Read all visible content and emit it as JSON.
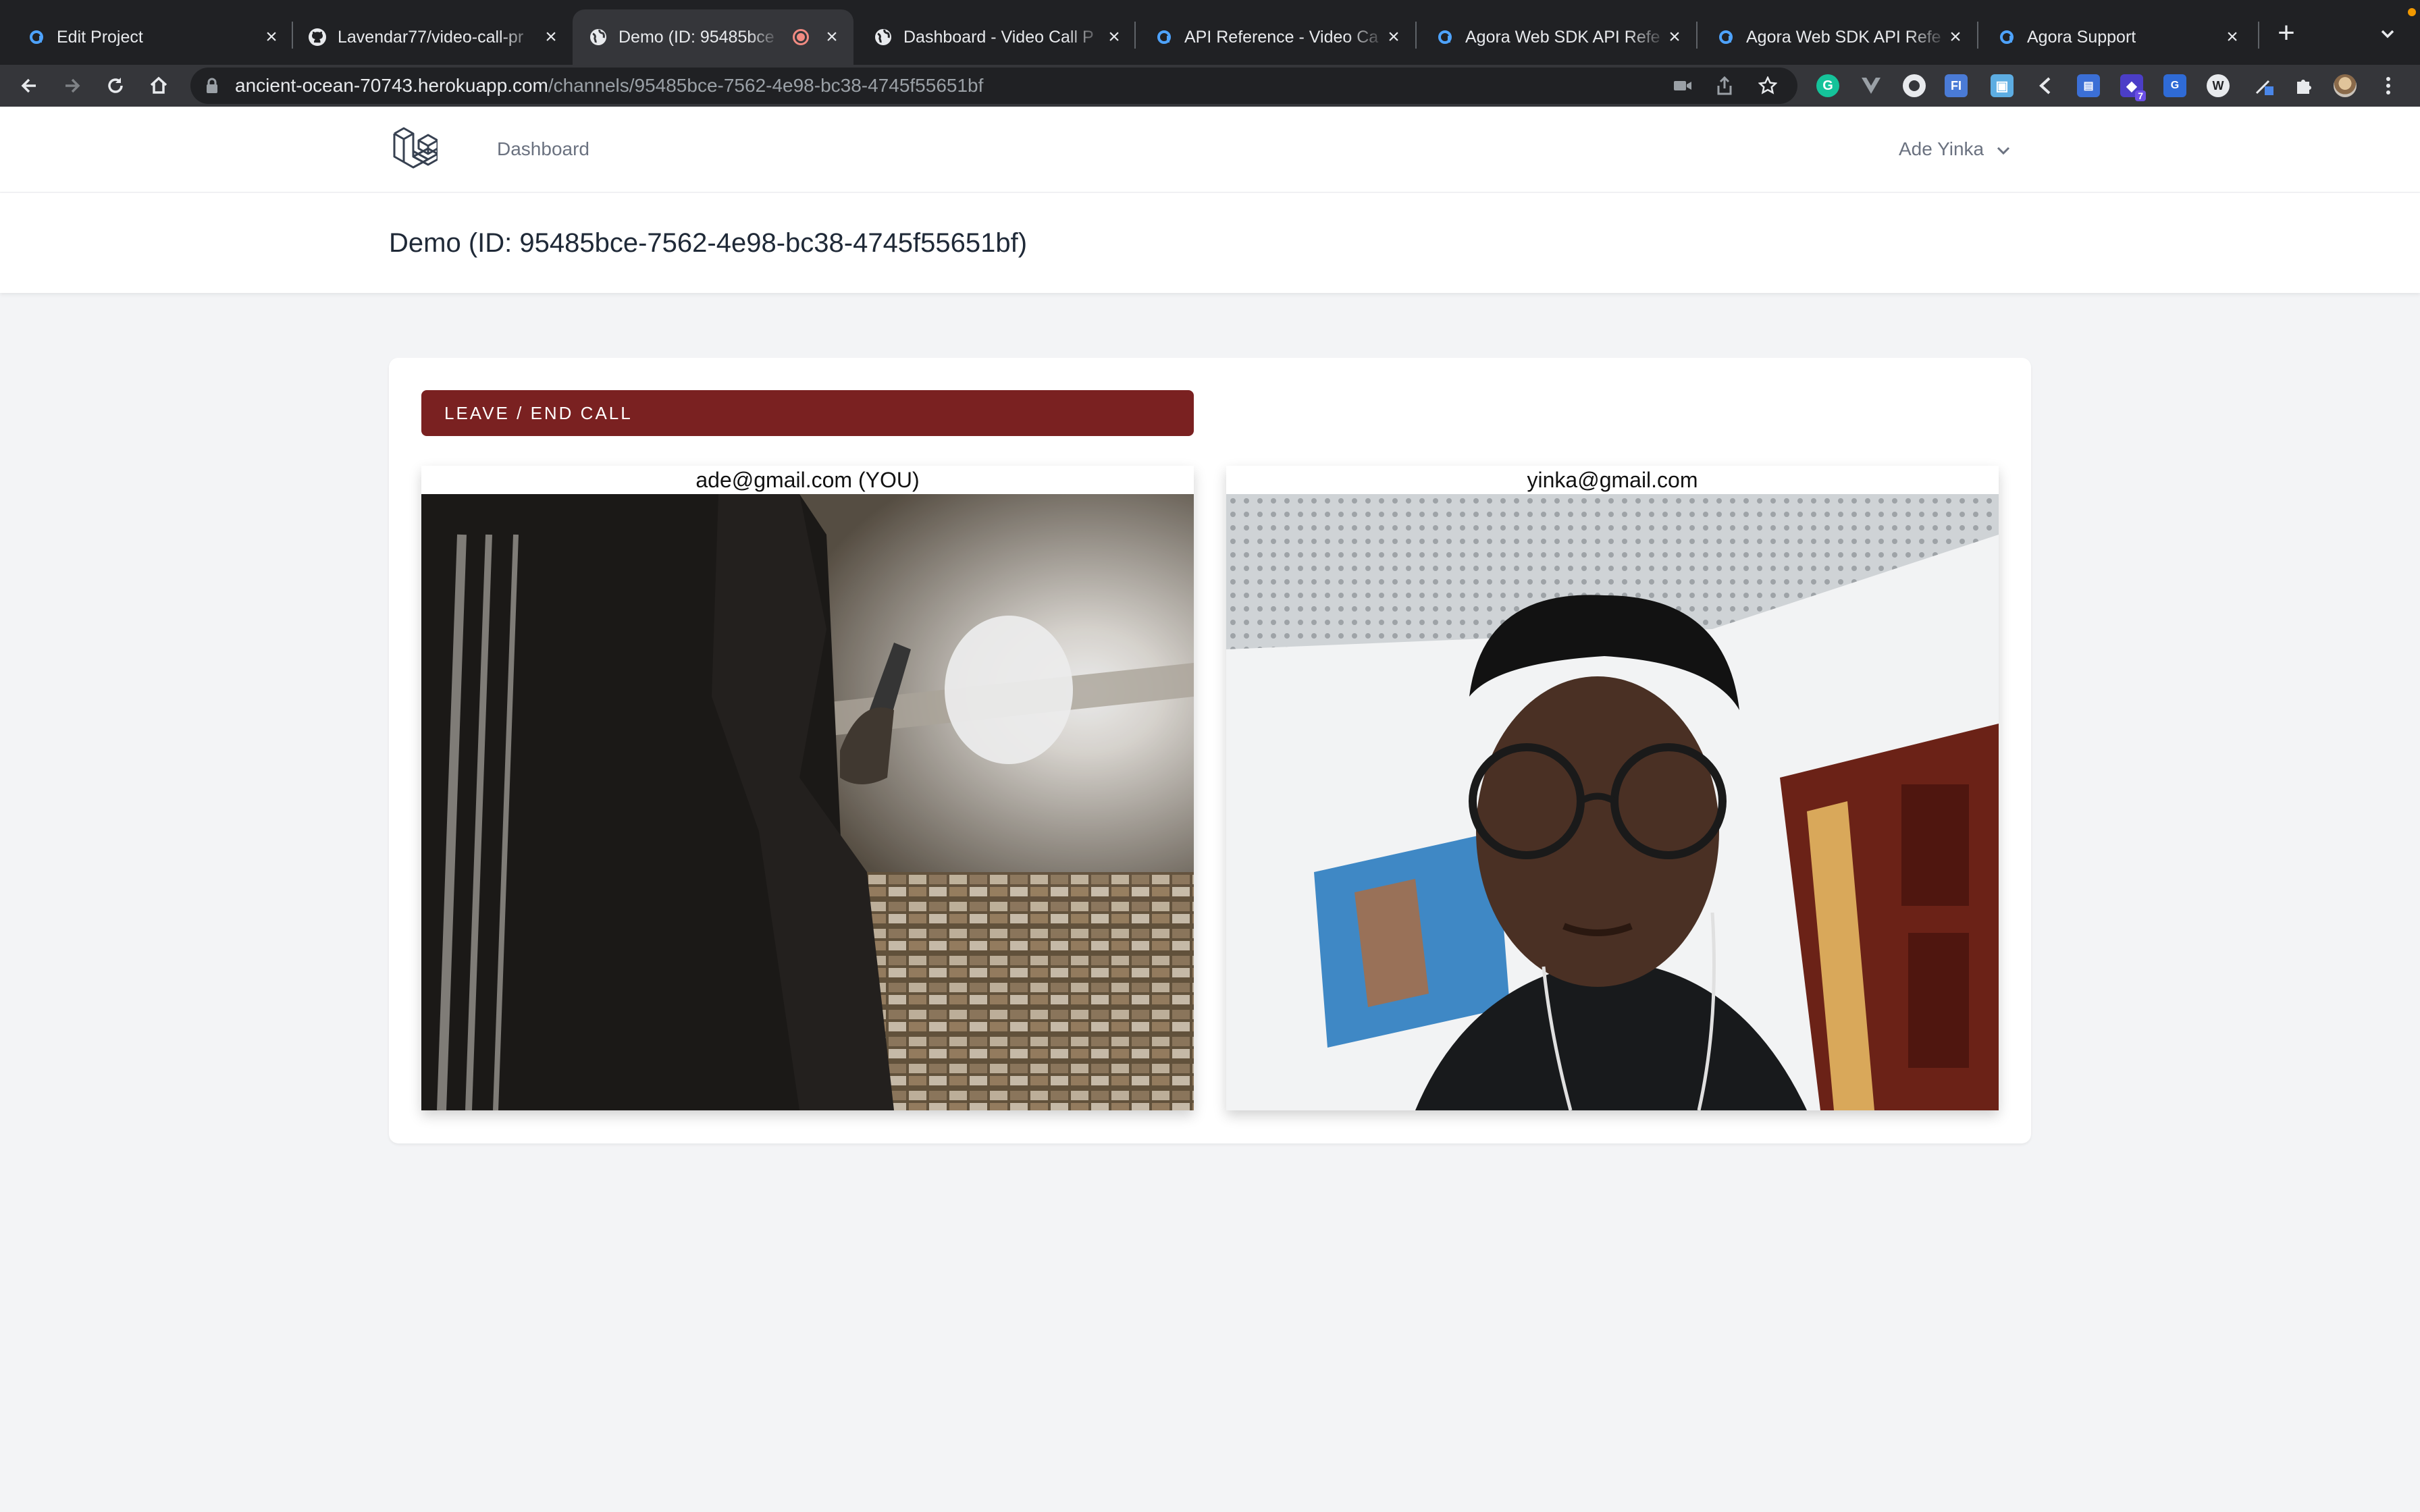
{
  "browser": {
    "tabs": [
      {
        "title": "Edit Project",
        "icon": "agora-icon",
        "active": false
      },
      {
        "title": "Lavendar77/video-call-pr",
        "icon": "github-icon",
        "active": false
      },
      {
        "title": "Demo (ID: 95485bce",
        "icon": "globe-icon",
        "active": true,
        "recording": true
      },
      {
        "title": "Dashboard - Video Call P",
        "icon": "globe-icon",
        "active": false
      },
      {
        "title": "API Reference - Video Ca",
        "icon": "agora-icon",
        "active": false
      },
      {
        "title": "Agora Web SDK API Refe",
        "icon": "agora-icon",
        "active": false
      },
      {
        "title": "Agora Web SDK API Refe",
        "icon": "agora-icon",
        "active": false
      },
      {
        "title": "Agora Support",
        "icon": "agora-icon",
        "active": false
      }
    ],
    "url_host": "ancient-ocean-70743.herokuapp.com",
    "url_path": "/channels/95485bce-7562-4e98-bc38-4745f55651bf",
    "extension_badge": "7"
  },
  "navbar": {
    "dashboard_link": "Dashboard",
    "user_name": "Ade Yinka"
  },
  "header": {
    "title": "Demo (ID: 95485bce-7562-4e98-bc38-4745f55651bf)"
  },
  "call": {
    "leave_label": "Leave / End Call",
    "local_label": "ade@gmail.com (YOU)",
    "remote_label": "yinka@gmail.com"
  },
  "colors": {
    "leave_button": "#7a2121",
    "page_bg": "#f3f4f6",
    "tab_strip": "#202124",
    "active_tab": "#35363a"
  }
}
